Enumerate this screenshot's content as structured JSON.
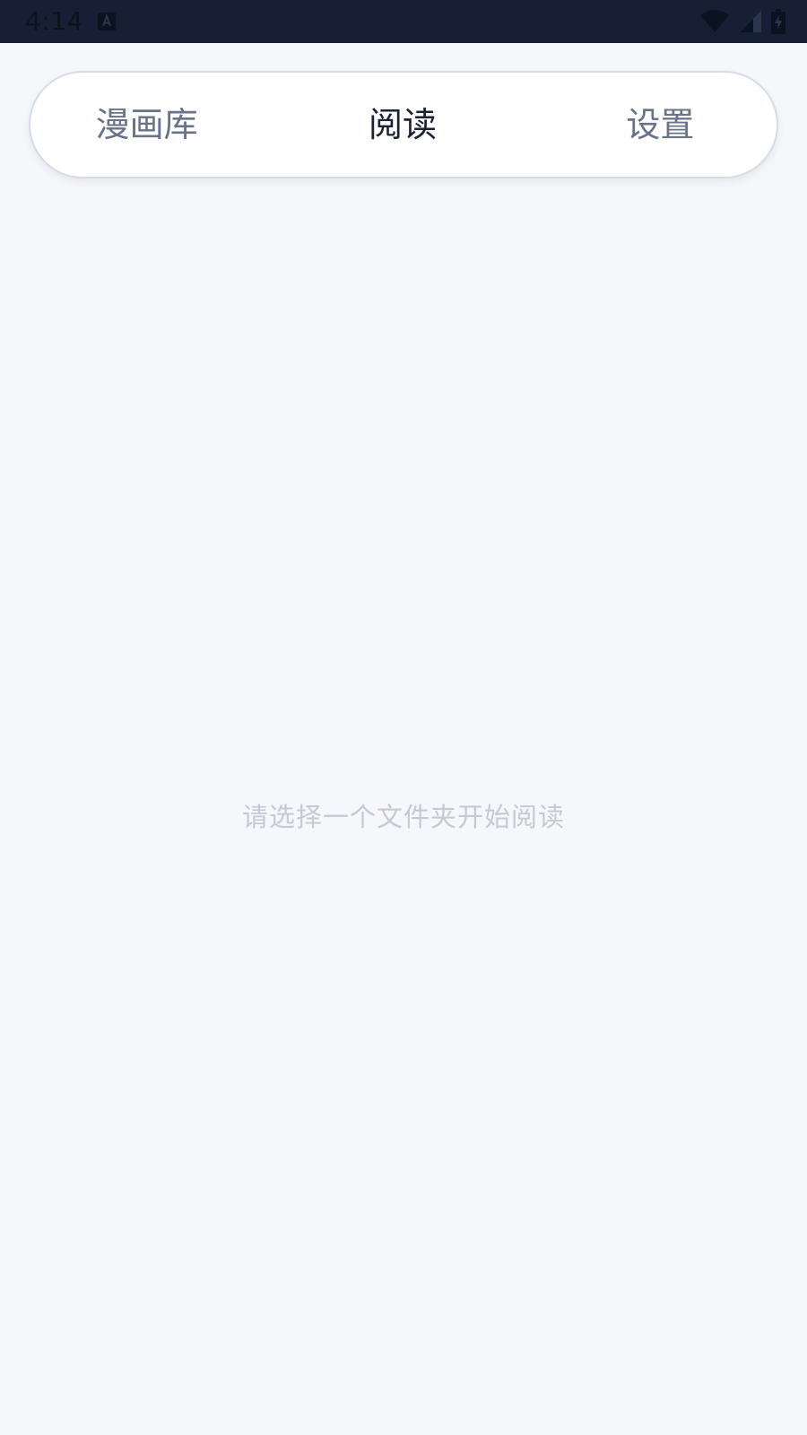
{
  "status_bar": {
    "time": "4:14",
    "icons": [
      "app-notification-icon",
      "wifi-icon",
      "cell-signal-icon",
      "battery-charging-icon"
    ]
  },
  "tabs": [
    {
      "label": "漫画库",
      "active": false
    },
    {
      "label": "阅读",
      "active": true
    },
    {
      "label": "设置",
      "active": false
    }
  ],
  "main": {
    "empty_message": "请选择一个文件夹开始阅读"
  },
  "colors": {
    "status_bar_bg": "#161f33",
    "page_bg": "#f5f7fb",
    "tab_active_text": "#1a2233",
    "tab_inactive_text": "#687387",
    "hint_text": "#c4c9d3"
  }
}
